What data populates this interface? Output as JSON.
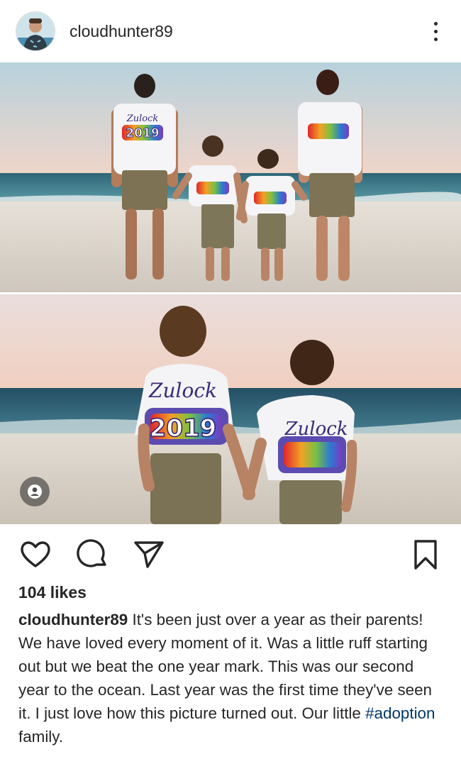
{
  "post": {
    "username": "cloudhunter89",
    "likes": "104 likes",
    "caption_user": "cloudhunter89",
    "caption_before_tag": " It's been just over a year as their parents! We have loved every moment of it. Was a little ruff starting out but we beat the one year mark. This was our second year to the ocean. Last year was the first time they've seen it. I just love how this picture turned out. Our little ",
    "hashtag": "#adoption",
    "caption_after_tag": " family."
  },
  "photos": [
    {
      "shirt_text": "Zulock",
      "shirt_year": "2019"
    },
    {
      "shirt_text": "Zulock",
      "shirt_year": "2019"
    }
  ],
  "icons": {
    "more": "more-vertical-icon",
    "like": "heart-icon",
    "comment": "comment-icon",
    "share": "send-icon",
    "save": "bookmark-icon",
    "tag": "user-tag-icon"
  },
  "colors": {
    "text": "#262626",
    "hashtag": "#00376b",
    "sky_top": "#b9d3de",
    "sky_bottom": "#f1d3c6",
    "sea": "#2e6b7c",
    "sand": "#d9d2c8"
  }
}
